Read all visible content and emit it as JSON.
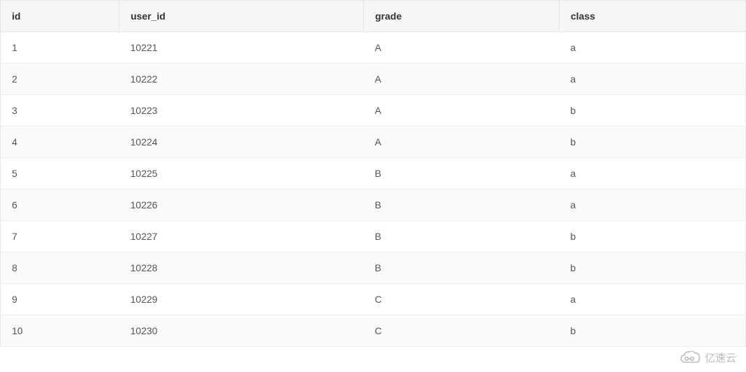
{
  "table": {
    "headers": [
      "id",
      "user_id",
      "grade",
      "class"
    ],
    "rows": [
      {
        "id": "1",
        "user_id": "10221",
        "grade": "A",
        "class": "a"
      },
      {
        "id": "2",
        "user_id": "10222",
        "grade": "A",
        "class": "a"
      },
      {
        "id": "3",
        "user_id": "10223",
        "grade": "A",
        "class": "b"
      },
      {
        "id": "4",
        "user_id": "10224",
        "grade": "A",
        "class": "b"
      },
      {
        "id": "5",
        "user_id": "10225",
        "grade": "B",
        "class": "a"
      },
      {
        "id": "6",
        "user_id": "10226",
        "grade": "B",
        "class": "a"
      },
      {
        "id": "7",
        "user_id": "10227",
        "grade": "B",
        "class": "b"
      },
      {
        "id": "8",
        "user_id": "10228",
        "grade": "B",
        "class": "b"
      },
      {
        "id": "9",
        "user_id": "10229",
        "grade": "C",
        "class": "a"
      },
      {
        "id": "10",
        "user_id": "10230",
        "grade": "C",
        "class": "b"
      }
    ]
  },
  "watermark": {
    "text": "亿速云"
  }
}
